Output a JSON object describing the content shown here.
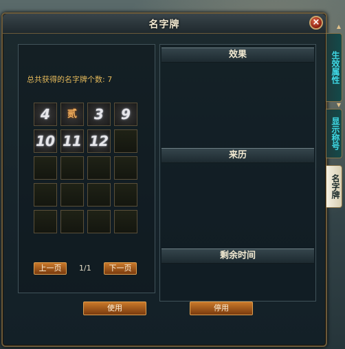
{
  "dialog": {
    "title": "名字牌",
    "close_symbol": "×"
  },
  "collection": {
    "count_text": "总共获得的名字牌个数: 7",
    "badges": [
      {
        "glyph": "4",
        "style": "silver"
      },
      {
        "glyph": "贰",
        "style": "gold"
      },
      {
        "glyph": "3",
        "style": "silver"
      },
      {
        "glyph": "9",
        "style": "silver"
      },
      {
        "glyph": "10",
        "style": "silver"
      },
      {
        "glyph": "11",
        "style": "silver"
      },
      {
        "glyph": "12",
        "style": "silver"
      }
    ],
    "total_slots": 20
  },
  "pager": {
    "prev_label": "上一页",
    "page_text": "1/1",
    "next_label": "下一页"
  },
  "details": {
    "effect_header": "效果",
    "source_header": "来历",
    "time_header": "剩余时间"
  },
  "actions": {
    "use_label": "使用",
    "disable_label": "停用"
  },
  "side_tabs": [
    {
      "label": "生效属性",
      "active": false
    },
    {
      "label": "显示称号",
      "active": false
    },
    {
      "label": "名字牌",
      "active": true
    }
  ]
}
